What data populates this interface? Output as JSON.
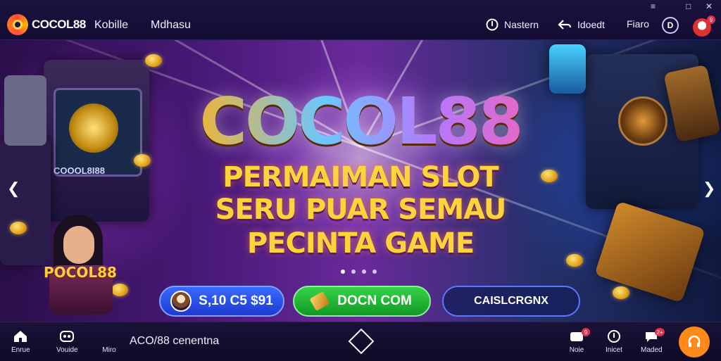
{
  "window": {
    "controls": [
      "≡",
      "□",
      "✕"
    ]
  },
  "header": {
    "logo_text": "COCOL88",
    "nav": [
      "Kobille",
      "Mdhasu"
    ],
    "items": [
      {
        "label": "Nastern",
        "icon": "info-circle-icon"
      },
      {
        "label": "Idoedt",
        "icon": "share-arrow-icon"
      },
      {
        "label": "Fiaro",
        "icon": ""
      }
    ],
    "round_button": "D",
    "avatar_badge": "9"
  },
  "hero": {
    "title": "COCOL88",
    "lines": [
      "PERMAIMAN SLOT",
      "SERU PUAR SEMAU",
      "PECINTA GAME"
    ],
    "machine_label": "COOOL8I88",
    "mascot_label": "POCOL88",
    "slides": 4,
    "active_slide": 0,
    "buttons": {
      "balance": "S,10 C5 $91",
      "primary": "DOCN COM",
      "secondary": "CAISLCRGNX"
    }
  },
  "bottom": {
    "left_nav": [
      {
        "label": "Enrue",
        "icon": "home-icon"
      },
      {
        "label": "Vouide",
        "icon": "controller-icon"
      },
      {
        "label": "Miro",
        "icon": "user-icon"
      }
    ],
    "title": "ACO/88 cenentna",
    "right_nav": [
      {
        "label": "Noie",
        "icon": "message-icon",
        "badge": "9"
      },
      {
        "label": "Inicet",
        "icon": "alert-icon",
        "badge": ""
      },
      {
        "label": "Maded",
        "icon": "chat-icon",
        "badge": "2+"
      }
    ]
  },
  "colors": {
    "accent_orange": "#ff8a1a",
    "gold": "#ffd43a",
    "green": "#22b83a",
    "blue": "#2a52e8"
  }
}
